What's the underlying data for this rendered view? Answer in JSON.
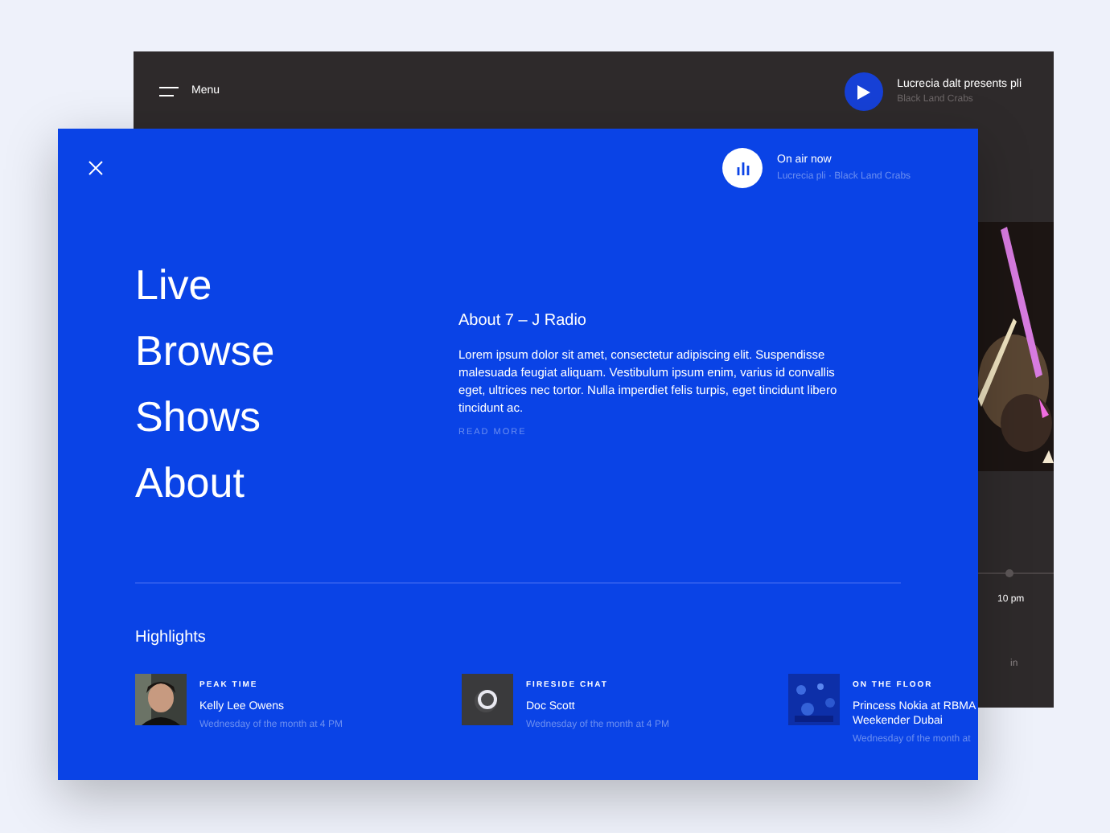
{
  "back_window": {
    "menu_label": "Menu",
    "now_playing": {
      "title": "Lucrecia dalt presents pli",
      "subtitle": "Black Land Crabs"
    },
    "time_label": "10 pm",
    "column_label": "in"
  },
  "overlay": {
    "on_air": {
      "title": "On air now",
      "subtitle": "Lucrecia pli · Black Land Crabs"
    },
    "nav": [
      {
        "label": "Live"
      },
      {
        "label": "Browse"
      },
      {
        "label": "Shows"
      },
      {
        "label": "About"
      }
    ],
    "about": {
      "title": "About 7 – J Radio",
      "body": "Lorem ipsum dolor sit amet, consectetur adipiscing elit. Suspendisse malesuada feugiat aliquam. Vestibulum ipsum enim, varius id convallis eget, ultrices nec tortor. Nulla imperdiet felis turpis, eget tincidunt libero tincidunt ac.",
      "link": "READ MORE"
    },
    "highlights": {
      "title": "Highlights",
      "items": [
        {
          "category": "PEAK TIME",
          "title": "Kelly Lee Owens",
          "time": "Wednesday of the month at 4 PM"
        },
        {
          "category": "FIRESIDE CHAT",
          "title": "Doc Scott",
          "time": "Wednesday of the month at 4 PM"
        },
        {
          "category": "ON THE FLOOR",
          "title": "Princess Nokia at RBMA Weekender Dubai",
          "time": "Wednesday of the month at"
        }
      ]
    }
  }
}
